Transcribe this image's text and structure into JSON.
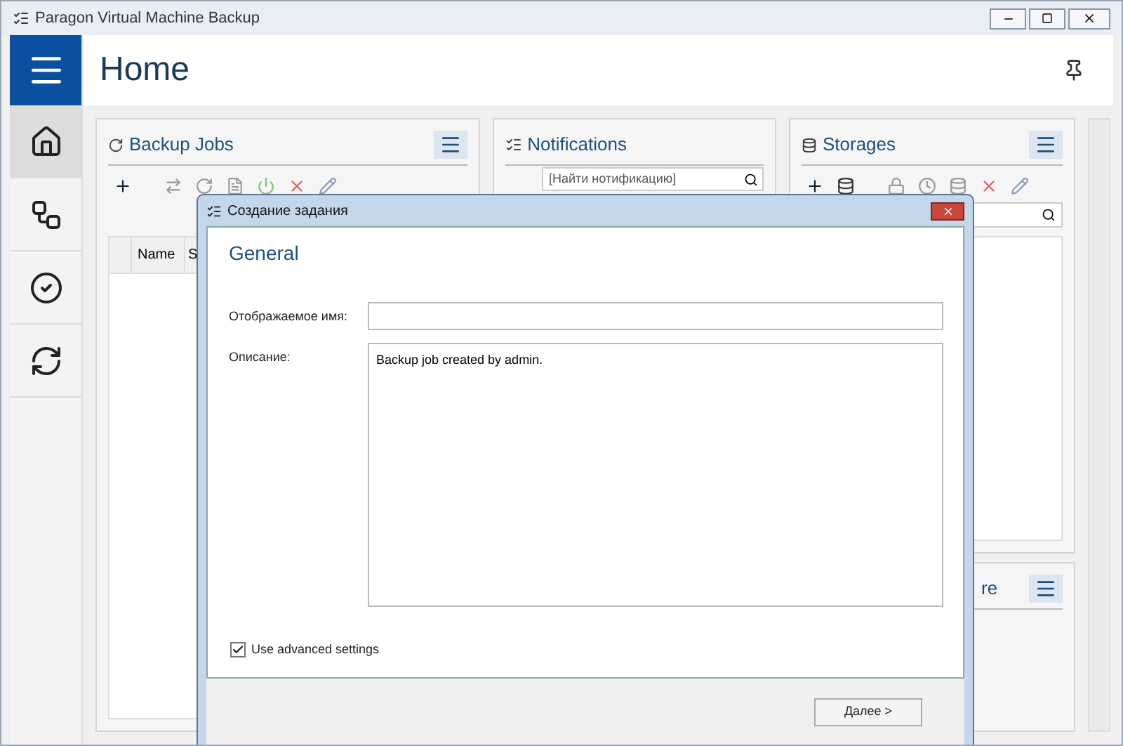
{
  "window": {
    "title": "Paragon Virtual Machine Backup"
  },
  "header": {
    "title": "Home"
  },
  "sidebar": {
    "items": [
      {
        "selected": true
      },
      {
        "selected": false
      },
      {
        "selected": false
      },
      {
        "selected": false
      }
    ]
  },
  "panels": {
    "backup_jobs": {
      "title": "Backup Jobs",
      "columns": [
        "Name",
        "S"
      ]
    },
    "notifications": {
      "title": "Notifications",
      "search": {
        "placeholder": "[Найти нотификацию]"
      }
    },
    "storages": {
      "title": "Storages"
    },
    "panel_4": {
      "title": "re"
    }
  },
  "dialog": {
    "title": "Создание задания",
    "heading": "General",
    "fields": [
      {
        "label": "Отображаемое имя:",
        "kind": "input"
      },
      {
        "label": "Описание:",
        "kind": "textarea",
        "value": "Backup job created by admin."
      }
    ],
    "checkbox": {
      "label": "Use advanced settings",
      "checked": true
    },
    "next_button": "Далее >"
  }
}
